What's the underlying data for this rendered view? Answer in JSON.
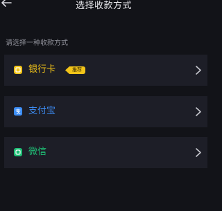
{
  "header": {
    "title": "选择收款方式",
    "back_icon": "arrow-left-icon"
  },
  "subtitle": "请选择一种收款方式",
  "options": [
    {
      "label": "银行卡",
      "badge": "推荐",
      "icon": "bank-card-icon",
      "color": "#f2c419"
    },
    {
      "label": "支付宝",
      "icon": "alipay-icon",
      "color": "#3d8ef7"
    },
    {
      "label": "微信",
      "icon": "wechat-icon",
      "color": "#1fbf76"
    }
  ],
  "colors": {
    "background": "#121318",
    "card": "#1d1e27",
    "badge": "#f2c419",
    "chevron": "#c8c9d0"
  }
}
